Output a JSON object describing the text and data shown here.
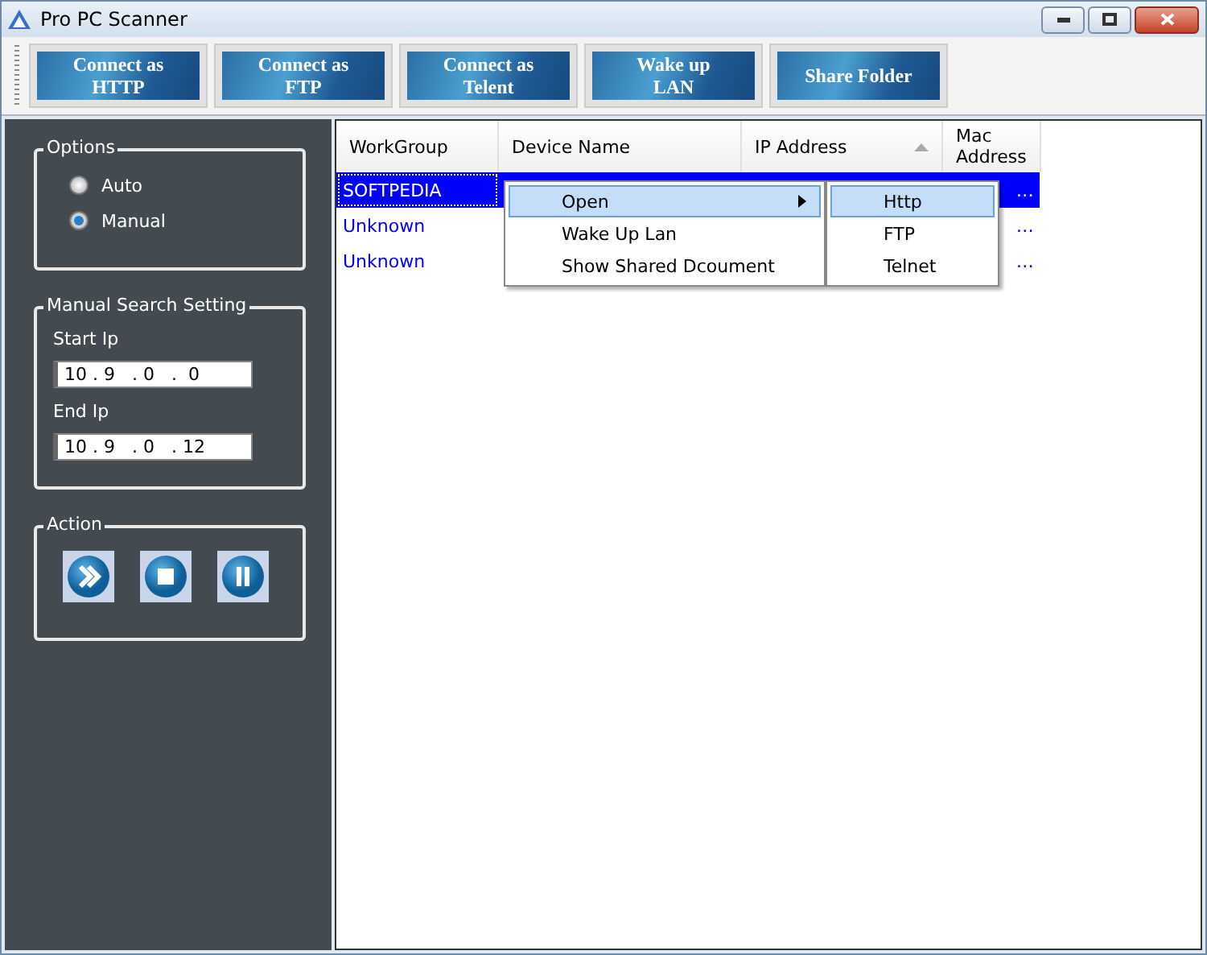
{
  "window": {
    "title": "Pro PC Scanner"
  },
  "toolbar": [
    "Connect as\nHTTP",
    "Connect as\nFTP",
    "Connect as\nTelent",
    "Wake up\nLAN",
    "Share Folder"
  ],
  "options": {
    "title": "Options",
    "radios": [
      {
        "label": "Auto",
        "selected": false
      },
      {
        "label": "Manual",
        "selected": true
      }
    ]
  },
  "manual_search": {
    "title": "Manual Search Setting",
    "fields": [
      {
        "label": "Start Ip",
        "value": "10 . 9   . 0   .  0"
      },
      {
        "label": "End Ip",
        "value": "10 . 9   . 0   . 12"
      }
    ]
  },
  "action": {
    "title": "Action",
    "buttons": [
      {
        "kind": "start"
      },
      {
        "kind": "stop"
      },
      {
        "kind": "pause"
      }
    ]
  },
  "table": {
    "columns": [
      "WorkGroup",
      "Device Name",
      "IP Address",
      "Mac\nAddress"
    ],
    "rows": [
      {
        "workgroup": "SOFTPEDIA",
        "mac": "…",
        "selected": true
      },
      {
        "workgroup": "Unknown",
        "mac": "…",
        "selected": false
      },
      {
        "workgroup": "Unknown",
        "mac": "…",
        "selected": false
      }
    ]
  },
  "context_menu": {
    "items": [
      {
        "label": "Open",
        "submenu": true,
        "selected": true
      },
      {
        "label": "Wake Up Lan",
        "submenu": false,
        "selected": false
      },
      {
        "label": "Show Shared Dcoument",
        "submenu": false,
        "selected": false
      }
    ]
  },
  "submenu": {
    "items": [
      {
        "label": "Http",
        "selected": true
      },
      {
        "label": "FTP",
        "selected": false
      },
      {
        "label": "Telnet",
        "selected": false
      }
    ]
  }
}
